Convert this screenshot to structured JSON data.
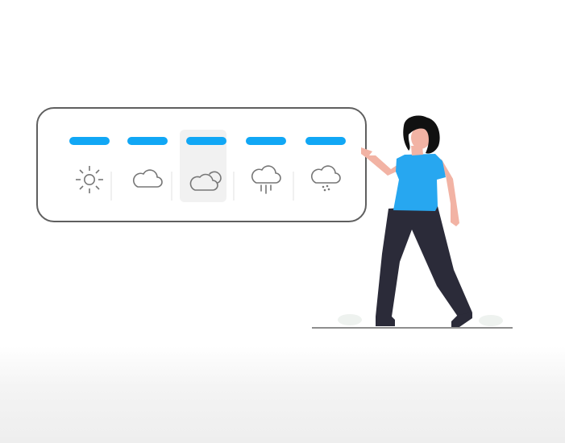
{
  "colors": {
    "accent": "#11a7f5",
    "outline": "#5f5f5f",
    "icon_stroke": "#777777",
    "shirt": "#27a7f0",
    "pants": "#2b2b39",
    "skin": "#f2b3a4",
    "hair": "#111111",
    "ground": "#8e8e8e"
  },
  "forecast": {
    "days": [
      {
        "icon": "sun-icon",
        "selected": false
      },
      {
        "icon": "cloud-icon",
        "selected": false
      },
      {
        "icon": "partly-cloudy-icon",
        "selected": true
      },
      {
        "icon": "rain-cloud-icon",
        "selected": false
      },
      {
        "icon": "hail-cloud-icon",
        "selected": false
      }
    ]
  }
}
